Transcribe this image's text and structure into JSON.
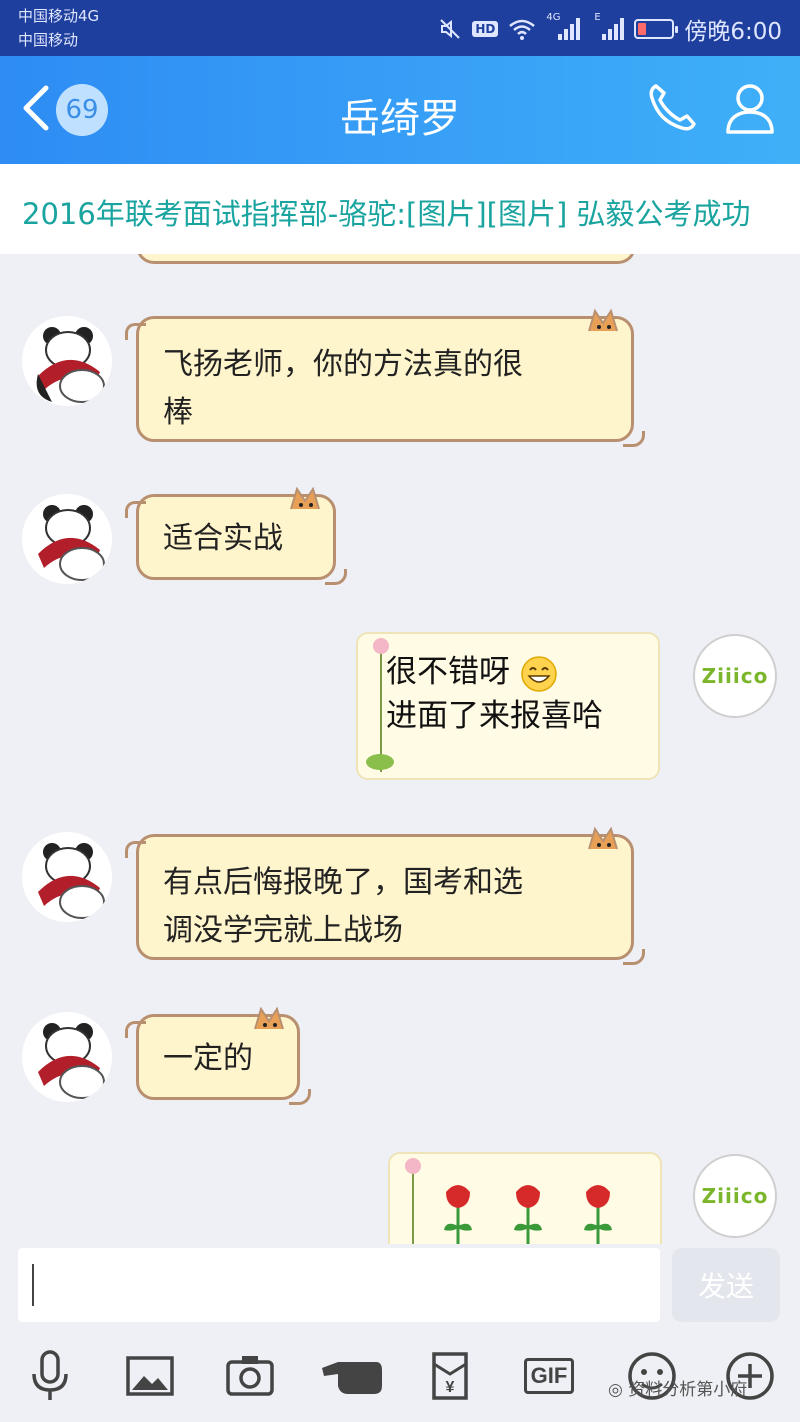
{
  "status_bar": {
    "carrier_primary": "中国移动4G",
    "carrier_secondary": "中国移动",
    "hd_label": "HD",
    "signal1_label": "4G",
    "signal2_label": "E",
    "time": "傍晚6:00"
  },
  "header": {
    "unread_count": "69",
    "title": "岳绮罗"
  },
  "pinned": {
    "text": "2016年联考面试指挥部-骆驼:[图片][图片] 弘毅公考成功"
  },
  "messages": [
    {
      "side": "left",
      "text_line1": "飞扬老师，你的方法真的很",
      "text_line2": "棒"
    },
    {
      "side": "left",
      "text": "适合实战"
    },
    {
      "side": "right",
      "text_line1": "很不错呀",
      "text_line2": "进面了来报喜哈"
    },
    {
      "side": "left",
      "text_line1": "有点后悔报晚了，国考和选",
      "text_line2": "调没学完就上战场"
    },
    {
      "side": "left",
      "text": "一定的"
    },
    {
      "side": "right",
      "content": "three roses"
    }
  ],
  "my_avatar_text": "Ziiico",
  "input": {
    "value": "",
    "send_label": "发送"
  },
  "toolbar": {
    "gif_label": "GIF",
    "items": [
      "mic-icon",
      "image-icon",
      "camera-icon",
      "hand-icon",
      "red-packet-icon",
      "gif-icon",
      "emoji-icon",
      "plus-icon"
    ]
  },
  "watermark": "资料分析第小府",
  "colors": {
    "status_bg": "#1f3f9e",
    "header_gradient_start": "#2e8cf4",
    "header_gradient_end": "#3fb0f8",
    "pinned_text": "#1aa4a0",
    "chat_bg": "#eef0f5",
    "cat_bubble_bg": "#fff5cc",
    "lotus_bubble_bg": "#fffbe5"
  }
}
